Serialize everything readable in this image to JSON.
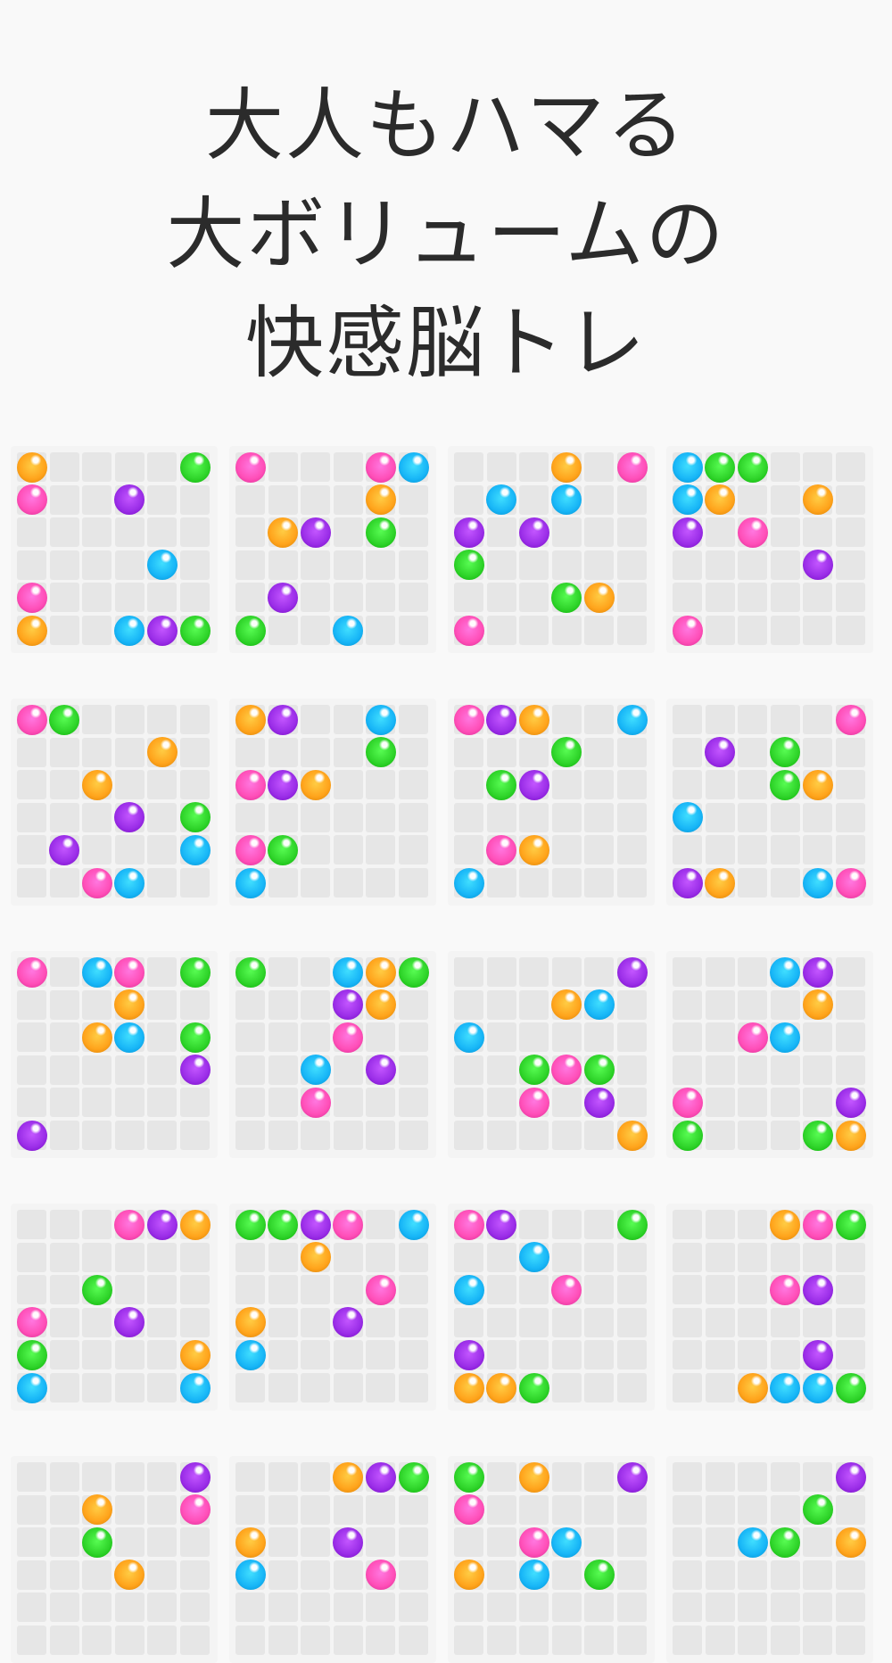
{
  "headline": {
    "lines": [
      "大人もハマる",
      "大ボリュームの",
      "快感脳トレ"
    ]
  },
  "colors": {
    "background": "#f9f9f9",
    "board": "#f4f4f4",
    "cell": "#e6e6e6",
    "text": "#2b2b2b",
    "balls": {
      "O": "#ffa41c",
      "P": "#ff4fb8",
      "V": "#9b2ee8",
      "C": "#18b6f7",
      "G": "#2fd42a"
    }
  },
  "puzzles": [
    [
      "O....G",
      "P..V..",
      "......",
      "....C.",
      "P.....",
      "O..CVG"
    ],
    [
      "P...PC",
      "....O.",
      ".OV.G.",
      "......",
      ".V....",
      "G..C.."
    ],
    [
      "...O.P",
      ".C.C..",
      "V.V...",
      "G.....",
      "...GO.",
      "P....."
    ],
    [
      "CGG...",
      "CO..O.",
      "V.P...",
      "....V.",
      "......",
      "P....."
    ],
    [
      "PG....",
      "....O.",
      "..O...",
      "...V.G",
      ".V...C",
      "..PC.."
    ],
    [
      "OV..C.",
      "....G.",
      "PVO...",
      "......",
      "PG....",
      "C....."
    ],
    [
      "PVO..C",
      "...G..",
      ".GV...",
      "......",
      ".PO...",
      "C....."
    ],
    [
      ".....P",
      ".V.G..",
      "...GO.",
      "C.....",
      "......",
      "VO..CP"
    ],
    [
      "P.CP.G",
      "...O..",
      "..OC.G",
      ".....V",
      "......",
      "V....."
    ],
    [
      "G..COG",
      "...VO.",
      "...P..",
      "..C.V.",
      "..P...",
      "......"
    ],
    [
      ".....V",
      "...OC.",
      "C.....",
      "..GPG.",
      "..P.V.",
      ".....O"
    ],
    [
      "...CV.",
      "....O.",
      "..PC..",
      "......",
      "P....V",
      "G...GO"
    ],
    [
      "...PVO",
      "......",
      "..G...",
      "P..V..",
      "G....O",
      "C....C"
    ],
    [
      "GGVP.C",
      "..O...",
      "....P.",
      "O..V..",
      "C.....",
      "......"
    ],
    [
      "PV...G",
      "..C...",
      "C..P..",
      "......",
      "V.....",
      "OOG..."
    ],
    [
      "...OPG",
      "......",
      "...PV.",
      "......",
      "....V.",
      "..OCCG"
    ],
    [
      ".....V",
      "..O..P",
      "..G...",
      "...O..",
      "......",
      "......"
    ],
    [
      "...OVG",
      "......",
      "O..V..",
      "C...P.",
      "......",
      "......"
    ],
    [
      "G.O..V",
      "P.....",
      "..PC..",
      "O.C.G.",
      "......",
      "......"
    ],
    [
      ".....V",
      "....G.",
      "..CG.O",
      "......",
      "......",
      "......"
    ]
  ]
}
